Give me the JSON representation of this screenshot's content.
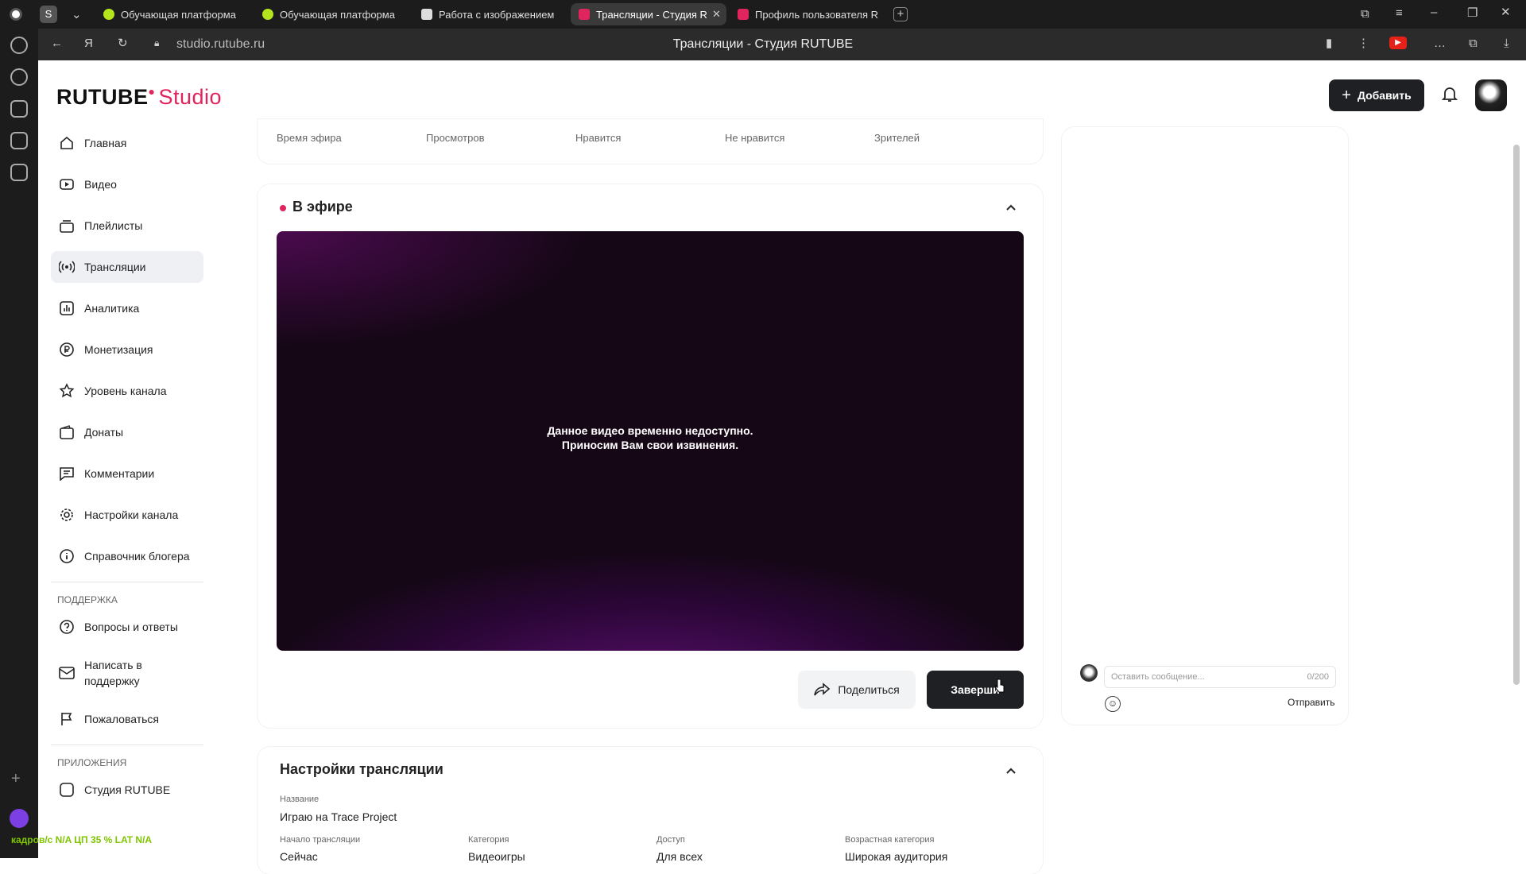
{
  "browser": {
    "tabs": [
      {
        "label": "Обучающая платформа",
        "fav_color": "#b5e61d"
      },
      {
        "label": "Обучающая платформа",
        "fav_color": "#b5e61d"
      },
      {
        "label": "Работа с изображением",
        "fav_color": "#dddddd"
      },
      {
        "label": "Трансляции - Студия R",
        "fav_color": "#e0245e"
      },
      {
        "label": "Профиль пользователя R",
        "fav_color": "#e0245e"
      }
    ],
    "url": "studio.rutube.ru",
    "window_title": "Трансляции - Студия RUTUBE"
  },
  "header": {
    "logo_main": "RUTUBE",
    "logo_studio": "Studio",
    "add_label": "Добавить"
  },
  "nav": {
    "items": [
      {
        "label": "Главная",
        "icon": "home-icon"
      },
      {
        "label": "Видео",
        "icon": "video-icon"
      },
      {
        "label": "Плейлисты",
        "icon": "playlist-icon"
      },
      {
        "label": "Трансляции",
        "icon": "broadcast-icon"
      },
      {
        "label": "Аналитика",
        "icon": "analytics-icon"
      },
      {
        "label": "Монетизация",
        "icon": "ruble-icon"
      },
      {
        "label": "Уровень канала",
        "icon": "star-icon"
      },
      {
        "label": "Донаты",
        "icon": "wallet-icon"
      },
      {
        "label": "Комментарии",
        "icon": "comment-icon"
      },
      {
        "label": "Настройки канала",
        "icon": "gear-icon"
      },
      {
        "label": "Справочник блогера",
        "icon": "info-icon"
      }
    ],
    "support_heading": "ПОДДЕРЖКА",
    "support_items": [
      {
        "label": "Вопросы и ответы",
        "icon": "question-icon"
      },
      {
        "label": "Написать в поддержку",
        "icon": "mail-icon"
      },
      {
        "label": "Пожаловаться",
        "icon": "flag-icon"
      }
    ],
    "apps_heading": "ПРИЛОЖЕНИЯ",
    "apps_item": "Студия RUTUBE"
  },
  "stats": {
    "labels": [
      "Время эфира",
      "Просмотров",
      "Нравится",
      "Не нравится",
      "Зрителей"
    ]
  },
  "live": {
    "title": "В эфире",
    "message_line1": "Данное видео временно недоступно.",
    "message_line2": "Приносим Вам свои извинения.",
    "share_label": "Поделиться",
    "end_label": "Заверши"
  },
  "settings": {
    "title": "Настройки трансляции",
    "name_label": "Название",
    "name_value": "Играю на Trace Project",
    "fields": [
      {
        "label": "Начало трансляции",
        "value": "Сейчас"
      },
      {
        "label": "Категория",
        "value": "Видеоигры"
      },
      {
        "label": "Доступ",
        "value": "Для всех"
      },
      {
        "label": "Возрастная категория",
        "value": "Широкая аудитория"
      }
    ]
  },
  "chat": {
    "placeholder": "Оставить сообщение...",
    "counter": "0/200",
    "send_label": "Отправить"
  },
  "overlay": {
    "text": "кадров/с N/A   ЦП 35 %   LAT N/A"
  },
  "colors": {
    "accent": "#e0245e",
    "dark_button": "#1f2024"
  }
}
